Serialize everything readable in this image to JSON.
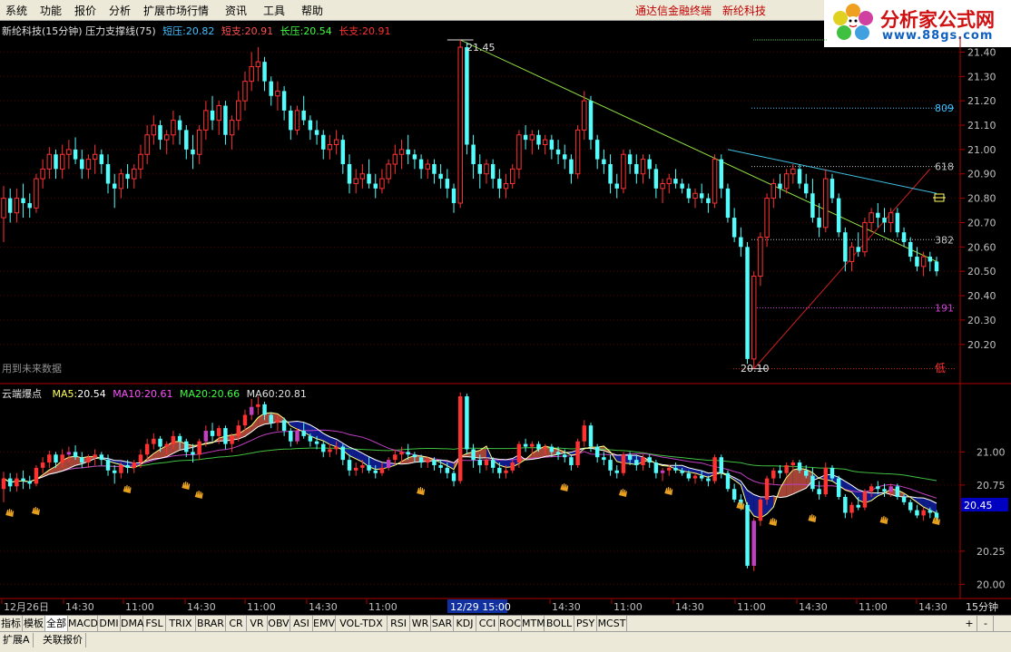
{
  "menu": {
    "items": [
      "系统",
      "功能",
      "报价",
      "分析",
      "扩展市场行情",
      "资讯",
      "工具",
      "帮助"
    ],
    "right_links": [
      "通达信金融终端",
      "新纶科技"
    ]
  },
  "logo": {
    "title": "分析家公式网",
    "url": "www.88gs.com"
  },
  "upper": {
    "header_name": "新纶科技(15分钟) 压力支撑线(75)",
    "short_pressure_label": "短压:",
    "short_pressure": "20.82",
    "short_support_label": "短支:",
    "short_support": "20.91",
    "long_pressure_label": "长压:",
    "long_pressure": "20.54",
    "long_support_label": "长支:",
    "long_support": "20.91",
    "future_data_note": "用到未来数据",
    "high_label": "21.45",
    "low_label": "20.10",
    "low_marker": "低",
    "fib_labels": [
      {
        "text": "809",
        "price": 21.17,
        "color": "#40c0ff"
      },
      {
        "text": "618",
        "price": 20.93,
        "color": "#c0c0c0"
      },
      {
        "text": "382",
        "price": 20.63,
        "color": "#c0c0c0"
      },
      {
        "text": "191",
        "price": 20.35,
        "color": "#d040d0"
      }
    ],
    "price_ticks": [
      "21.40",
      "21.30",
      "21.20",
      "21.10",
      "21.00",
      "20.90",
      "20.80",
      "20.70",
      "20.60",
      "20.50",
      "20.40",
      "20.30",
      "20.20"
    ]
  },
  "lower": {
    "header_name": "云端爆点",
    "ma5_label": "MA5:",
    "ma5": "20.54",
    "ma10_label": "MA10:",
    "ma10": "20.61",
    "ma20_label": "MA20:",
    "ma20": "20.66",
    "ma60_label": "MA60:",
    "ma60": "20.81",
    "price_ticks": [
      "21.00",
      "20.75",
      "20.25",
      "20.00"
    ],
    "current_price": "20.45"
  },
  "time_axis": {
    "labels": [
      "12月26日",
      "14:30",
      "11:00",
      "14:30",
      "11:00",
      "14:30",
      "11:00",
      "14:30",
      "11:00",
      "14:30",
      "11:00",
      "14:30",
      "11:00",
      "14:30"
    ],
    "cursor_label": "12/29 15:00",
    "period": "15分钟"
  },
  "tabs": [
    "指标",
    "模板",
    "全部",
    "MACD",
    "DMI",
    "DMA",
    "FSL",
    "TRIX",
    "BRAR",
    "CR",
    "VR",
    "OBV",
    "ASI",
    "EMV",
    "VOL-TDX",
    "RSI",
    "WR",
    "SAR",
    "KDJ",
    "CCI",
    "ROC",
    "MTM",
    "BOLL",
    "PSY",
    "MCST"
  ],
  "tab_selected": "全部",
  "zoom_controls": [
    "+",
    "-"
  ],
  "bottom_tabs": [
    "扩展A",
    "关联报价"
  ],
  "colors": {
    "up": "#ff3232",
    "down": "#54fcfc",
    "ma5": "#ffffff",
    "ma10": "#ff50ff",
    "ma20": "#40ff40",
    "ma60": "#ffffff",
    "axis": "#b00000",
    "trend_green": "#90e040",
    "trend_cyan": "#40c0e0",
    "trend_red": "#d02020"
  },
  "chart_data": {
    "type": "candlestick",
    "title": "新纶科技(15分钟)",
    "ylim": [
      20.05,
      21.45
    ],
    "candles": [
      [
        20.72,
        20.85,
        20.62,
        20.8
      ],
      [
        20.8,
        20.84,
        20.7,
        20.74
      ],
      [
        20.74,
        20.84,
        20.7,
        20.8
      ],
      [
        20.8,
        20.86,
        20.72,
        20.78
      ],
      [
        20.78,
        20.82,
        20.72,
        20.76
      ],
      [
        20.76,
        20.9,
        20.74,
        20.88
      ],
      [
        20.88,
        20.96,
        20.84,
        20.92
      ],
      [
        20.92,
        21.01,
        20.88,
        20.98
      ],
      [
        20.98,
        21.0,
        20.88,
        20.92
      ],
      [
        20.92,
        21.02,
        20.88,
        20.98
      ],
      [
        20.98,
        21.04,
        20.92,
        21.0
      ],
      [
        21.0,
        21.05,
        20.94,
        20.96
      ],
      [
        20.96,
        21.0,
        20.88,
        20.92
      ],
      [
        20.92,
        20.98,
        20.88,
        20.96
      ],
      [
        20.96,
        21.02,
        20.9,
        20.98
      ],
      [
        20.98,
        21.0,
        20.9,
        20.94
      ],
      [
        20.94,
        20.98,
        20.82,
        20.86
      ],
      [
        20.86,
        20.9,
        20.76,
        20.84
      ],
      [
        20.84,
        20.92,
        20.8,
        20.9
      ],
      [
        20.9,
        20.94,
        20.84,
        20.88
      ],
      [
        20.88,
        20.94,
        20.84,
        20.92
      ],
      [
        20.92,
        21.02,
        20.88,
        20.98
      ],
      [
        20.98,
        21.1,
        20.94,
        21.06
      ],
      [
        21.06,
        21.14,
        21.02,
        21.1
      ],
      [
        21.1,
        21.12,
        21.0,
        21.04
      ],
      [
        21.04,
        21.08,
        20.98,
        21.06
      ],
      [
        21.06,
        21.16,
        21.02,
        21.12
      ],
      [
        21.12,
        21.14,
        21.02,
        21.08
      ],
      [
        21.08,
        21.1,
        20.96,
        21.0
      ],
      [
        21.0,
        21.06,
        20.92,
        20.98
      ],
      [
        20.98,
        21.1,
        20.94,
        21.08
      ],
      [
        21.08,
        21.2,
        21.04,
        21.16
      ],
      [
        21.16,
        21.22,
        21.08,
        21.12
      ],
      [
        21.12,
        21.2,
        21.06,
        21.18
      ],
      [
        21.18,
        21.2,
        21.02,
        21.06
      ],
      [
        21.06,
        21.14,
        21.0,
        21.12
      ],
      [
        21.12,
        21.24,
        21.08,
        21.2
      ],
      [
        21.2,
        21.32,
        21.16,
        21.28
      ],
      [
        21.28,
        21.4,
        21.24,
        21.34
      ],
      [
        21.34,
        21.42,
        21.28,
        21.36
      ],
      [
        21.36,
        21.38,
        21.24,
        21.28
      ],
      [
        21.28,
        21.3,
        21.18,
        21.22
      ],
      [
        21.22,
        21.28,
        21.16,
        21.24
      ],
      [
        21.24,
        21.26,
        21.12,
        21.16
      ],
      [
        21.16,
        21.18,
        21.04,
        21.08
      ],
      [
        21.08,
        21.18,
        21.06,
        21.16
      ],
      [
        21.16,
        21.22,
        21.1,
        21.12
      ],
      [
        21.12,
        21.14,
        21.04,
        21.08
      ],
      [
        21.08,
        21.12,
        21.02,
        21.06
      ],
      [
        21.06,
        21.08,
        20.96,
        21.0
      ],
      [
        21.0,
        21.06,
        20.96,
        21.02
      ],
      [
        21.02,
        21.08,
        20.98,
        21.04
      ],
      [
        21.04,
        21.06,
        20.9,
        20.94
      ],
      [
        20.94,
        20.98,
        20.82,
        20.86
      ],
      [
        20.86,
        20.92,
        20.82,
        20.88
      ],
      [
        20.88,
        20.94,
        20.84,
        20.9
      ],
      [
        20.9,
        20.96,
        20.84,
        20.86
      ],
      [
        20.86,
        20.9,
        20.8,
        20.84
      ],
      [
        20.84,
        20.92,
        20.82,
        20.88
      ],
      [
        20.88,
        20.96,
        20.86,
        20.94
      ],
      [
        20.94,
        21.02,
        20.9,
        20.98
      ],
      [
        20.98,
        21.04,
        20.92,
        21.0
      ],
      [
        21.0,
        21.06,
        20.94,
        20.98
      ],
      [
        20.98,
        21.0,
        20.92,
        20.96
      ],
      [
        20.96,
        20.98,
        20.88,
        20.92
      ],
      [
        20.92,
        20.96,
        20.88,
        20.94
      ],
      [
        20.94,
        20.96,
        20.86,
        20.9
      ],
      [
        20.9,
        20.94,
        20.84,
        20.88
      ],
      [
        20.88,
        20.92,
        20.8,
        20.84
      ],
      [
        20.84,
        20.86,
        20.74,
        20.78
      ],
      [
        20.78,
        21.45,
        20.76,
        21.42
      ],
      [
        21.42,
        21.44,
        20.98,
        21.02
      ],
      [
        21.02,
        21.06,
        20.88,
        20.94
      ],
      [
        20.94,
        20.98,
        20.84,
        20.9
      ],
      [
        20.9,
        20.96,
        20.86,
        20.94
      ],
      [
        20.94,
        20.96,
        20.84,
        20.88
      ],
      [
        20.88,
        20.92,
        20.8,
        20.84
      ],
      [
        20.84,
        20.9,
        20.8,
        20.86
      ],
      [
        20.86,
        20.94,
        20.84,
        20.92
      ],
      [
        20.92,
        21.08,
        20.88,
        21.06
      ],
      [
        21.06,
        21.1,
        21.0,
        21.04
      ],
      [
        21.04,
        21.08,
        20.98,
        21.06
      ],
      [
        21.06,
        21.08,
        21.0,
        21.02
      ],
      [
        21.02,
        21.06,
        20.98,
        21.04
      ],
      [
        21.04,
        21.06,
        20.96,
        21.0
      ],
      [
        21.0,
        21.04,
        20.94,
        20.98
      ],
      [
        20.98,
        21.02,
        20.92,
        20.96
      ],
      [
        20.96,
        20.98,
        20.86,
        20.9
      ],
      [
        20.9,
        21.1,
        20.88,
        21.08
      ],
      [
        21.08,
        21.24,
        21.04,
        21.2
      ],
      [
        21.2,
        21.22,
        21.0,
        21.04
      ],
      [
        21.04,
        21.06,
        20.92,
        20.96
      ],
      [
        20.96,
        21.0,
        20.9,
        20.94
      ],
      [
        20.94,
        20.98,
        20.82,
        20.86
      ],
      [
        20.86,
        20.9,
        20.8,
        20.84
      ],
      [
        20.84,
        21.0,
        20.82,
        20.98
      ],
      [
        20.98,
        21.0,
        20.9,
        20.94
      ],
      [
        20.94,
        20.98,
        20.86,
        20.9
      ],
      [
        20.9,
        20.98,
        20.86,
        20.96
      ],
      [
        20.96,
        20.98,
        20.88,
        20.92
      ],
      [
        20.92,
        20.94,
        20.8,
        20.84
      ],
      [
        20.84,
        20.88,
        20.78,
        20.86
      ],
      [
        20.86,
        20.9,
        20.82,
        20.88
      ],
      [
        20.88,
        20.92,
        20.84,
        20.86
      ],
      [
        20.86,
        20.88,
        20.82,
        20.84
      ],
      [
        20.84,
        20.86,
        20.78,
        20.8
      ],
      [
        20.8,
        20.84,
        20.76,
        20.82
      ],
      [
        20.82,
        20.86,
        20.78,
        20.8
      ],
      [
        20.8,
        20.82,
        20.74,
        20.78
      ],
      [
        20.78,
        20.98,
        20.76,
        20.96
      ],
      [
        20.96,
        20.98,
        20.8,
        20.84
      ],
      [
        20.84,
        20.86,
        20.7,
        20.72
      ],
      [
        20.72,
        20.76,
        20.62,
        20.64
      ],
      [
        20.64,
        20.68,
        20.56,
        20.6
      ],
      [
        20.6,
        20.62,
        20.12,
        20.14
      ],
      [
        20.14,
        20.5,
        20.1,
        20.48
      ],
      [
        20.48,
        20.66,
        20.44,
        20.64
      ],
      [
        20.64,
        20.82,
        20.6,
        20.8
      ],
      [
        20.8,
        20.88,
        20.76,
        20.86
      ],
      [
        20.86,
        20.9,
        20.8,
        20.84
      ],
      [
        20.84,
        20.92,
        20.82,
        20.9
      ],
      [
        20.9,
        20.94,
        20.86,
        20.92
      ],
      [
        20.92,
        20.94,
        20.84,
        20.86
      ],
      [
        20.86,
        20.9,
        20.8,
        20.82
      ],
      [
        20.82,
        20.88,
        20.7,
        20.72
      ],
      [
        20.72,
        20.78,
        20.64,
        20.68
      ],
      [
        20.68,
        20.92,
        20.66,
        20.88
      ],
      [
        20.88,
        20.9,
        20.78,
        20.8
      ],
      [
        20.8,
        20.82,
        20.64,
        20.66
      ],
      [
        20.66,
        20.68,
        20.5,
        20.54
      ],
      [
        20.54,
        20.62,
        20.5,
        20.6
      ],
      [
        20.6,
        20.66,
        20.56,
        20.58
      ],
      [
        20.58,
        20.72,
        20.56,
        20.7
      ],
      [
        20.7,
        20.76,
        20.66,
        20.74
      ],
      [
        20.74,
        20.78,
        20.68,
        20.72
      ],
      [
        20.72,
        20.76,
        20.66,
        20.7
      ],
      [
        20.7,
        20.76,
        20.66,
        20.74
      ],
      [
        20.74,
        20.76,
        20.64,
        20.66
      ],
      [
        20.66,
        20.68,
        20.6,
        20.62
      ],
      [
        20.62,
        20.64,
        20.54,
        20.56
      ],
      [
        20.56,
        20.6,
        20.5,
        20.52
      ],
      [
        20.52,
        20.58,
        20.48,
        20.56
      ],
      [
        20.56,
        20.58,
        20.5,
        20.54
      ],
      [
        20.54,
        20.56,
        20.48,
        20.5
      ]
    ]
  }
}
